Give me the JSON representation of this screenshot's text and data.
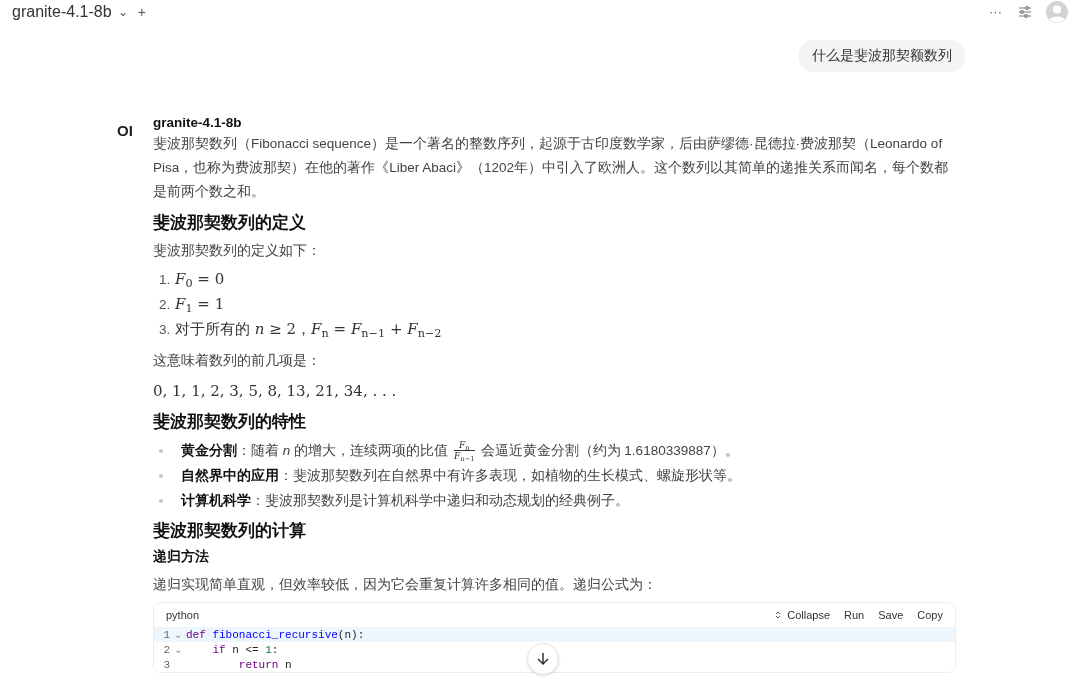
{
  "header": {
    "model": "granite-4.1-8b",
    "chevron": "⌄",
    "add": "+",
    "more": "···"
  },
  "user_message": "什么是斐波那契额数列",
  "assistant": {
    "avatar": "OI",
    "name": "granite-4.1-8b",
    "blocks": [
      {
        "kind": "paragraph",
        "text": "斐波那契数列（Fibonacci sequence）是一个著名的整数序列，起源于古印度数学家，后由萨缪德·昆德拉·费波那契（Leonardo of Pisa，也称为费波那契）在他的著作《Liber Abaci》（1202年）中引入了欧洲人。这个数列以其简单的递推关系而闻名，每个数都是前两个数之和。"
      },
      {
        "kind": "heading",
        "text": "斐波那契数列的定义"
      },
      {
        "kind": "paragraph",
        "text": "斐波那契数列的定义如下："
      },
      {
        "kind": "ordered",
        "items": [
          {
            "number": "1.",
            "text": "*F*$_{0}$ = 0"
          },
          {
            "number": "2.",
            "text": "*F*$_{1}$ = 1"
          },
          {
            "number": "3.",
            "text": "对于所有的 *n* ≥ 2，*F*$_{n}$ = *F*$_{n−1}$ + *F*$_{n−2}$"
          }
        ]
      },
      {
        "kind": "paragraph",
        "text": "这意味着数列的前几项是："
      },
      {
        "kind": "math",
        "text": "0, 1, 1, 2, 3, 5, 8, 13, 21, 34, . . ."
      },
      {
        "kind": "heading",
        "text": "斐波那契数列的特性"
      },
      {
        "kind": "bullets",
        "items": [
          {
            "term": "黄金分割",
            "text": "：随着 *n* 的增大，连续两项的比值",
            "fraction": {
              "numerator": "*F*$_{n}$",
              "denominator": "*F*$_{n−1}$"
            },
            "after": "会逼近黄金分割（约为 1.6180339887）。"
          },
          {
            "term": "自然界中的应用",
            "text": "：斐波那契数列在自然界中有许多表现，如植物的生长模式、螺旋形状等。"
          },
          {
            "term": "计算机科学",
            "text": "：斐波那契数列是计算机科学中递归和动态规划的经典例子。"
          }
        ]
      },
      {
        "kind": "heading",
        "text": "斐波那契数列的计算"
      },
      {
        "kind": "subheading",
        "text": "递归方法"
      },
      {
        "kind": "paragraph",
        "text": "递归实现简单直观，但效率较低，因为它会重复计算许多相同的值。递归公式为："
      },
      {
        "kind": "code",
        "language": "python",
        "actions": [
          "Collapse",
          "Run",
          "Save",
          "Copy"
        ],
        "lines": [
          {
            "number": "1",
            "fold": "⌄",
            "selected": true,
            "tokens": [
              {
                "kind": "keyword",
                "text": "def"
              },
              {
                "kind": "function",
                "text": " fibonacci_recursive"
              },
              {
                "kind": "plain",
                "text": "(n):"
              }
            ]
          },
          {
            "number": "2",
            "fold": "⌄",
            "selected": false,
            "tokens": [
              {
                "kind": "keyword",
                "text": "    if"
              },
              {
                "kind": "plain",
                "text": " n <= "
              },
              {
                "kind": "number",
                "text": "1"
              },
              {
                "kind": "plain",
                "text": ":"
              }
            ]
          },
          {
            "number": "3",
            "selected": false,
            "tokens": [
              {
                "kind": "keyword",
                "text": "        return"
              },
              {
                "kind": "plain",
                "text": " n"
              }
            ]
          }
        ]
      }
    ]
  }
}
